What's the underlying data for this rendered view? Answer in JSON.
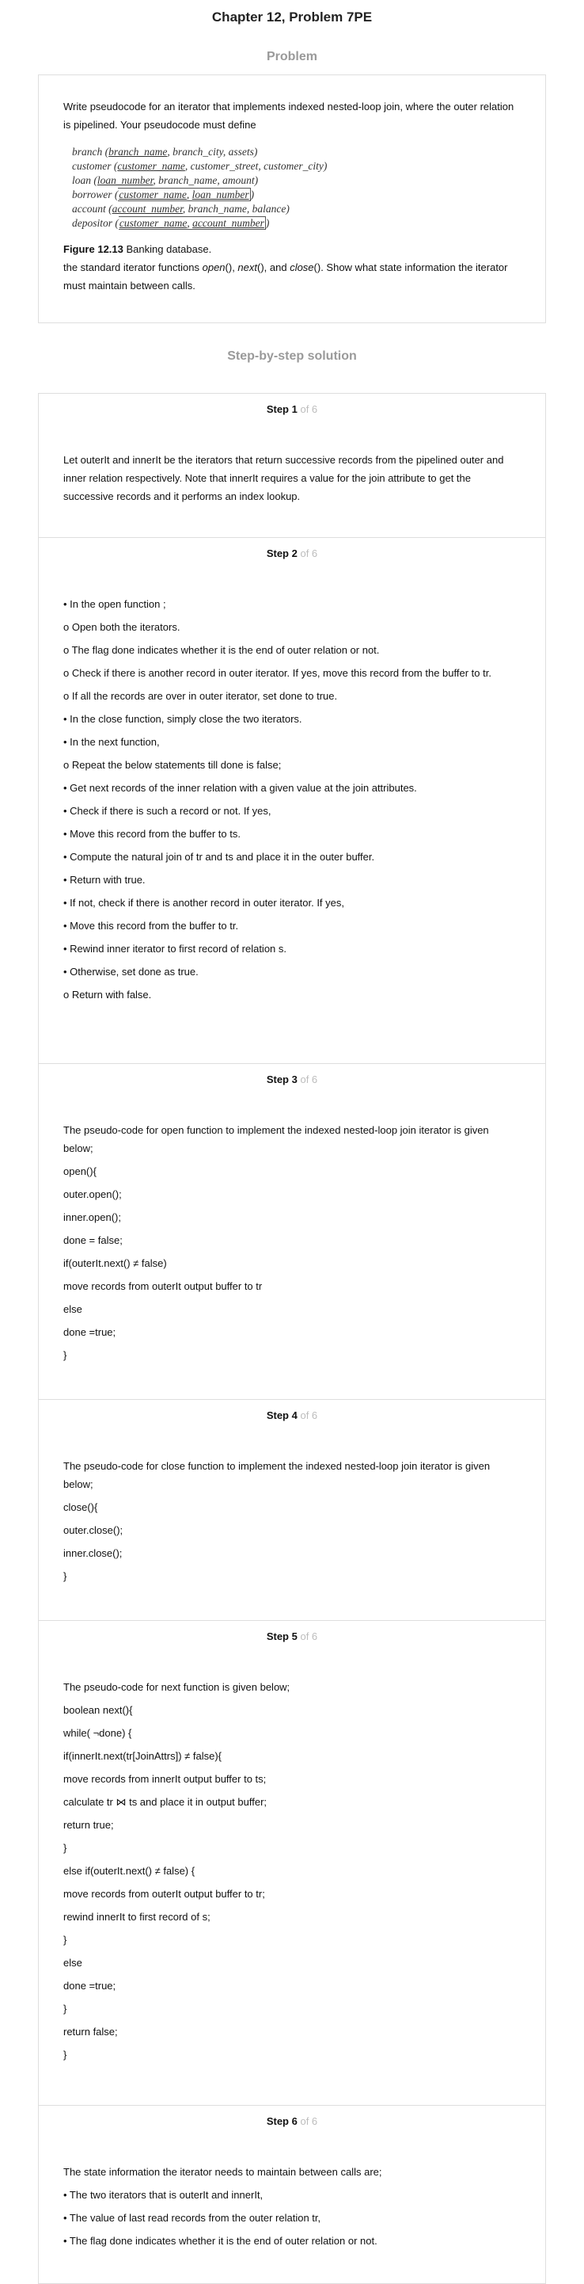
{
  "header": {
    "title": "Chapter 12, Problem 7PE"
  },
  "problem": {
    "heading": "Problem",
    "intro": "Write pseudocode for an iterator that implements indexed nested-loop join, where the outer relation is pipelined. Your pseudocode must define",
    "schema": [
      {
        "rel": "branch",
        "attrs": [
          {
            "text": "branch_name",
            "key": true
          },
          {
            "text": "branch_city",
            "key": false
          },
          {
            "text": "assets",
            "key": false
          }
        ]
      },
      {
        "rel": "customer",
        "attrs": [
          {
            "text": "customer_name",
            "key": true
          },
          {
            "text": "customer_street",
            "key": false
          },
          {
            "text": "customer_city",
            "key": false
          }
        ]
      },
      {
        "rel": "loan",
        "attrs": [
          {
            "text": "loan_number",
            "key": true
          },
          {
            "text": "branch_name",
            "key": false
          },
          {
            "text": "amount",
            "key": false
          }
        ]
      },
      {
        "rel": "borrower",
        "attrs": [
          {
            "text": "customer_name",
            "key": true
          },
          {
            "text": "loan_number",
            "key": true
          }
        ]
      },
      {
        "rel": "account",
        "attrs": [
          {
            "text": "account_number",
            "key": true
          },
          {
            "text": "branch_name",
            "key": false
          },
          {
            "text": "balance",
            "key": false
          }
        ]
      },
      {
        "rel": "depositor",
        "attrs": [
          {
            "text": "customer_name",
            "key": true
          },
          {
            "text": "account_number",
            "key": true
          }
        ]
      }
    ],
    "figure_label": "Figure 12.13",
    "figure_text": "Banking database.",
    "outro_pre": "the standard iterator functions ",
    "fn_open": "open",
    "fn_open_tail": "(), ",
    "fn_next": "next",
    "fn_next_tail": "(), and ",
    "fn_close": "close",
    "outro_post": "(). Show what state information the iterator must maintain between calls."
  },
  "solution": {
    "heading": "Step-by-step solution",
    "of_total": "of 6",
    "steps": [
      {
        "label": "Step 1",
        "lines": [
          "Let outerIt and innerIt be the iterators that return successive records from the pipelined outer and inner relation respectively. Note that innerIt requires a value for the join attribute to get the successive records and it performs an index lookup."
        ]
      },
      {
        "label": "Step 2",
        "lines": [
          "• In the open function ;",
          "o Open both the iterators.",
          "o The flag done indicates whether it is the end of outer relation or not.",
          "o Check if there is another record in outer iterator. If yes, move this record from the buffer to tr.",
          "o If all the records are over in outer iterator, set done to true.",
          "• In the close function, simply close the two iterators.",
          "• In the next function,",
          "o Repeat the below statements till done is false;",
          "• Get next records of the inner relation with a given value at the join attributes.",
          "• Check if there is such a record or not. If yes,",
          "• Move this record from the buffer to ts.",
          "• Compute the natural join of tr and ts and place it in the outer buffer.",
          "• Return with true.",
          "• If not, check if there is another record in outer iterator. If yes,",
          "• Move this record from the buffer to tr.",
          "• Rewind inner iterator to first record of relation s.",
          "• Otherwise, set done as true.",
          "o Return with false."
        ]
      },
      {
        "label": "Step 3",
        "lines": [
          "The pseudo-code for open function to implement the indexed nested-loop join iterator is given below;",
          "open(){",
          "outer.open();",
          "inner.open();",
          "done = false;",
          "if(outerIt.next()  ≠ false)",
          "move records from outerIt output buffer to tr",
          "else",
          "done =true;",
          "}"
        ]
      },
      {
        "label": "Step 4",
        "lines": [
          "The pseudo-code for close function to implement the indexed nested-loop join iterator is given below;",
          "close(){",
          "outer.close();",
          "inner.close();",
          "}"
        ]
      },
      {
        "label": "Step 5",
        "lines": [
          "The pseudo-code for next function is given below;",
          "boolean next(){",
          "while( ¬done) {",
          "if(innerIt.next(tr[JoinAttrs])  ≠ false){",
          "move records from innerIt output buffer to ts;",
          "calculate  tr ⋈ ts and place it in output buffer;",
          "return true;",
          "}",
          "else if(outerIt.next() ≠ false) {",
          "move records from outerIt output buffer to tr;",
          "rewind innerIt to first record of s;",
          "}",
          "else",
          "done =true;",
          "}",
          "return false;",
          "}"
        ]
      },
      {
        "label": "Step 6",
        "lines": [
          "The state information the iterator needs to maintain between calls are;",
          "• The two iterators that is outerIt and innerIt,",
          "• The value of last read records from the outer relation tr,",
          "• The flag done indicates whether it is the end of outer relation or not."
        ]
      }
    ]
  }
}
